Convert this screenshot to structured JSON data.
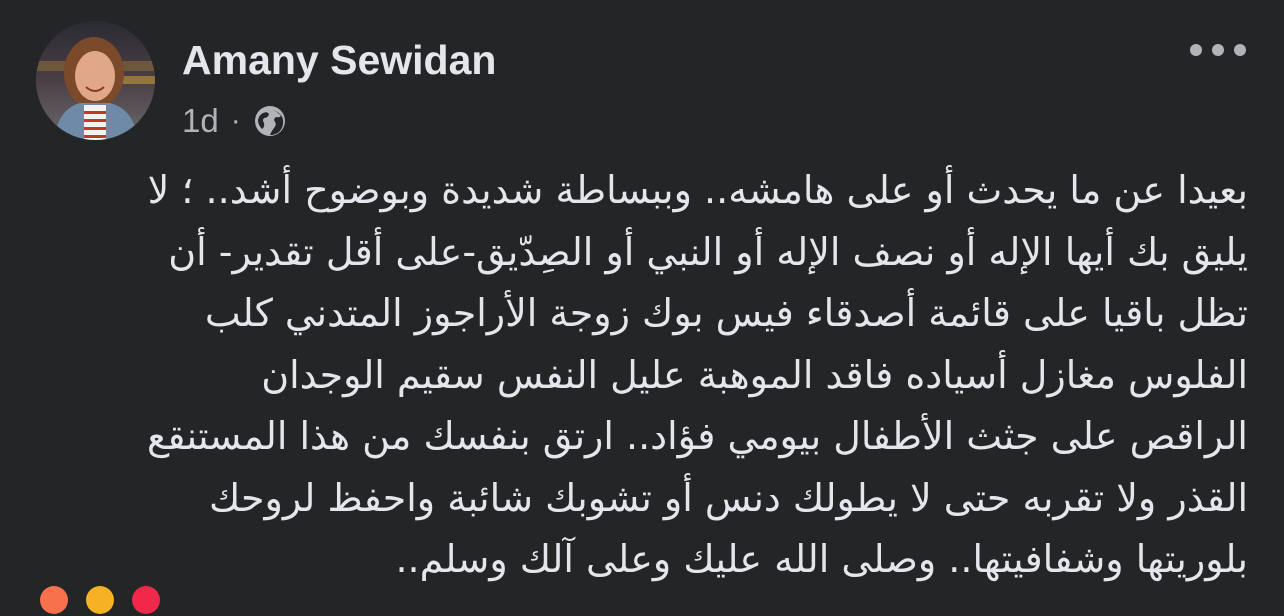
{
  "post": {
    "author_name": "Amany Sewidan",
    "timestamp": "1d",
    "separator": "·",
    "audience_icon": "globe-icon",
    "more_icon": "more-options-icon",
    "text_lines": [
      "بعيدا عن ما يحدث أو على هامشه.. وببساطة شديدة وبوضوح أشد.. ؛ لا",
      "يليق بك أيها الإله أو نصف الإله أو النبي أو الصِدّيق-على أقل تقدير- أن",
      "تظل باقيا على قائمة أصدقاء فيس بوك زوجة الأراجوز المتدني كلب",
      "الفلوس مغازل أسياده فاقد الموهبة عليل النفس سقيم الوجدان",
      "الراقص على جثث الأطفال بيومي فؤاد.. ارتق بنفسك من هذا المستنقع",
      "القذر ولا تقربه حتى لا يطولك دنس أو تشوبك شائبة واحفظ لروحك",
      "بلوريتها وشفافيتها.. وصلى الله عليك وعلى آلك وسلم.."
    ]
  },
  "colors": {
    "background": "#242526",
    "primary_text": "#e4e6eb",
    "secondary_text": "#b0b3b8",
    "reaction_colors": [
      "#f7714c",
      "#f7b125",
      "#f02849"
    ]
  }
}
